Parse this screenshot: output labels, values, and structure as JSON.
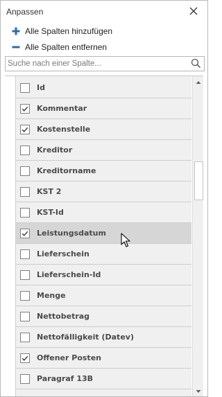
{
  "header": {
    "title": "Anpassen"
  },
  "actions": {
    "add_all_label": "Alle Spalten hinzufügen",
    "remove_all_label": "Alle Spalten entfernen"
  },
  "search": {
    "placeholder": "Suche nach einer Spalte...",
    "value": ""
  },
  "columns": [
    {
      "label": "Id",
      "checked": false
    },
    {
      "label": "Kommentar",
      "checked": true
    },
    {
      "label": "Kostenstelle",
      "checked": true
    },
    {
      "label": "Kreditor",
      "checked": false
    },
    {
      "label": "Kreditorname",
      "checked": false
    },
    {
      "label": "KST 2",
      "checked": false
    },
    {
      "label": "KST-Id",
      "checked": false
    },
    {
      "label": "Leistungsdatum",
      "checked": true,
      "hovered": true
    },
    {
      "label": "Lieferschein",
      "checked": false
    },
    {
      "label": "Lieferschein-Id",
      "checked": false
    },
    {
      "label": "Menge",
      "checked": false
    },
    {
      "label": "Nettobetrag",
      "checked": false
    },
    {
      "label": "Nettofälligkeit (Datev)",
      "checked": false
    },
    {
      "label": "Offener Posten",
      "checked": true
    },
    {
      "label": "Paragraf 13B",
      "checked": false
    }
  ],
  "colors": {
    "accent": "#2b6cb3",
    "row_bg": "#f0f0f0",
    "row_hover": "#d6d6d6"
  },
  "icons": {
    "close": "close-icon",
    "add": "plus-icon",
    "remove": "minus-icon",
    "search": "search-icon",
    "checkbox": "check-icon",
    "scroll_up": "chevron-up-icon",
    "scroll_down": "chevron-down-icon",
    "cursor": "mouse-pointer-icon"
  }
}
